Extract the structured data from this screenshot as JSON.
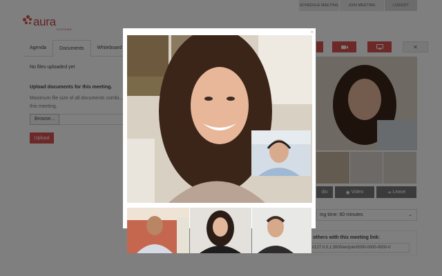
{
  "topnav": {
    "schedule": "SCHEDULE MEETING",
    "join": "JOIN MEETING",
    "logout": "LOGOUT"
  },
  "logo": {
    "name": "aura",
    "sub": "SYSTEMS"
  },
  "tabs": [
    {
      "label": "Agenda"
    },
    {
      "label": "Documents"
    },
    {
      "label": "Whiteboard"
    }
  ],
  "documents": {
    "empty_text": "No files uploaded yet",
    "upload_title": "Upload documents for this meeting.",
    "upload_note": "Maximum file size of all documents combi... this meeting.",
    "browse_label": "Browse...",
    "upload_label": "Upload"
  },
  "controls": {
    "audio_label": "dio",
    "video_label": "Video",
    "leave_label": "Leave"
  },
  "meeting": {
    "time_text": "ing time: 60 minutes"
  },
  "invite": {
    "label": "Invite others with this meeting link:",
    "link": "https://127.0.0.1:3000/en/join/0000-0000-0000-0"
  },
  "modal": {
    "close_glyph": "×"
  },
  "colors": {
    "brand": "#c8454a",
    "accent_button": "#d9534f",
    "overlay": "rgba(0,0,0,0.5)"
  }
}
